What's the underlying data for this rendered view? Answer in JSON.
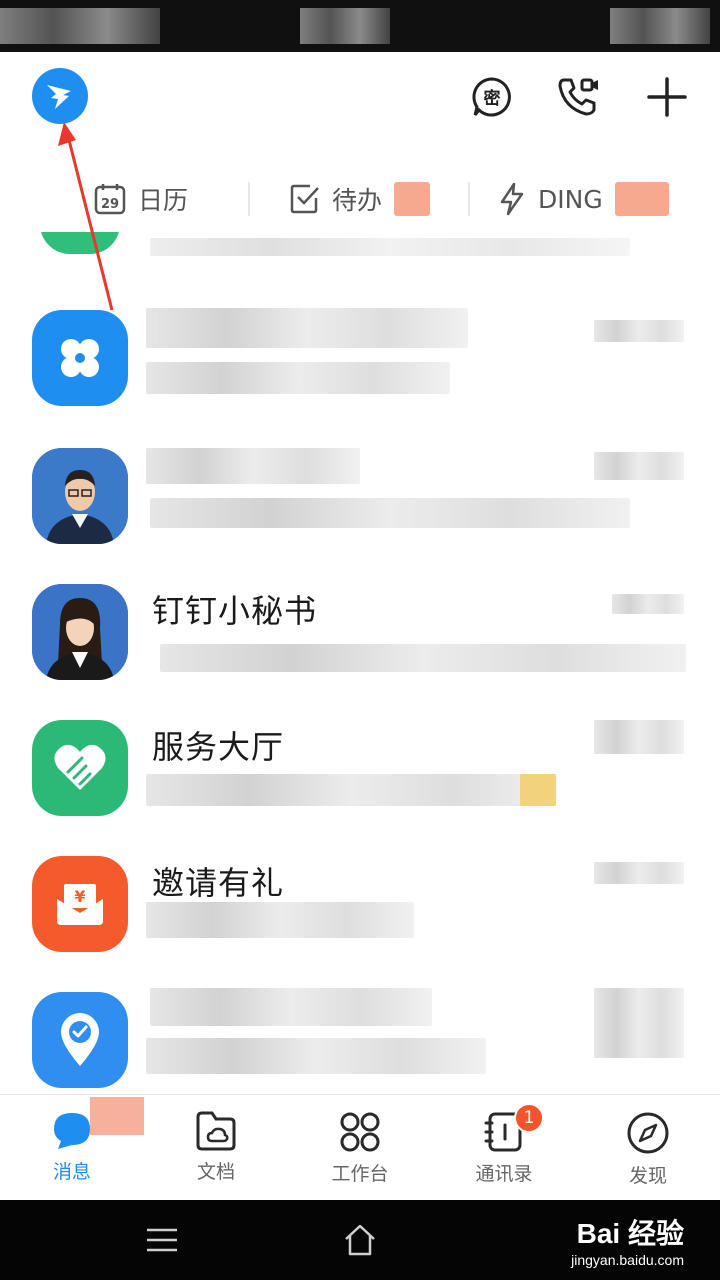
{
  "header": {
    "logo_icon": "dingtalk-logo-icon",
    "actions": [
      "secret-chat-icon",
      "video-call-icon",
      "plus-icon"
    ],
    "secret_glyph": "密"
  },
  "quick_tabs": [
    {
      "icon": "calendar-icon",
      "label": "日历",
      "date": "29"
    },
    {
      "icon": "todo-icon",
      "label": "待办"
    },
    {
      "icon": "ding-icon",
      "label": "DING"
    }
  ],
  "conversations": [
    {
      "title": "",
      "avatar_icon": "clover-app-icon",
      "color": "#1e8ef1"
    },
    {
      "title": "",
      "avatar_icon": "person-avatar-male",
      "color": "#3a7ac8"
    },
    {
      "title": "钉钉小秘书",
      "avatar_icon": "person-avatar-female",
      "color": "#3b74c6"
    },
    {
      "title": "服务大厅",
      "avatar_icon": "heart-hand-icon",
      "color": "#2cb978"
    },
    {
      "title": "邀请有礼",
      "avatar_icon": "red-envelope-icon",
      "color": "#f45a2a"
    },
    {
      "title": "",
      "avatar_icon": "location-check-icon",
      "color": "#2f8ef0"
    }
  ],
  "tabbar": {
    "items": [
      {
        "label": "消息",
        "icon": "message-icon",
        "active": true
      },
      {
        "label": "文档",
        "icon": "docs-folder-icon"
      },
      {
        "label": "工作台",
        "icon": "workbench-grid-icon"
      },
      {
        "label": "通讯录",
        "icon": "contacts-icon",
        "badge": "1"
      },
      {
        "label": "发现",
        "icon": "compass-icon"
      }
    ]
  },
  "watermark": {
    "brand": "Bai 经验",
    "url": "jingyan.baidu.com"
  },
  "colors": {
    "accent": "#1e8ef1",
    "badge": "#f2552c",
    "annotation": "#e8372c"
  }
}
